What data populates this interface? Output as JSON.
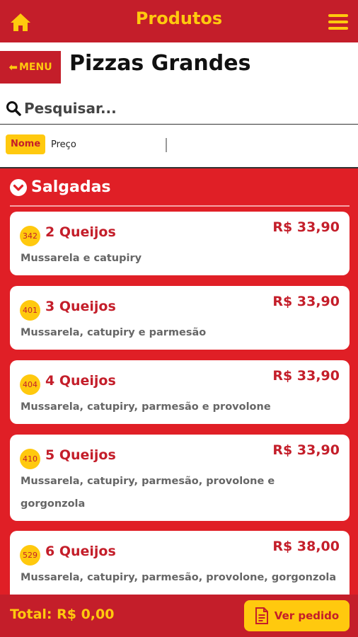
{
  "topbar": {
    "title": "Produtos",
    "home_icon": "home-icon",
    "menu_icon": "hamburger-icon"
  },
  "header": {
    "menu_button_label": "MENU",
    "category_title": "Pizzas Grandes"
  },
  "search": {
    "placeholder": "Pesquisar..."
  },
  "sort": {
    "options": [
      "Nome",
      "Preço"
    ],
    "selected": "Nome"
  },
  "section": {
    "title": "Salgadas"
  },
  "products": [
    {
      "code": "342",
      "name": "2 Queijos",
      "price": "R$ 33,90",
      "description": "Mussarela e catupiry"
    },
    {
      "code": "401",
      "name": "3 Queijos",
      "price": "R$ 33,90",
      "description": "Mussarela, catupiry e parmesão"
    },
    {
      "code": "404",
      "name": "4 Queijos",
      "price": "R$ 33,90",
      "description": "Mussarela, catupiry, parmesão e provolone"
    },
    {
      "code": "410",
      "name": "5 Queijos",
      "price": "R$ 33,90",
      "description": "Mussarela, catupiry, parmesão, provolone e gorgonzola"
    },
    {
      "code": "529",
      "name": "6 Queijos",
      "price": "R$ 38,00",
      "description": "Mussarela, catupiry, parmesão, provolone, gorgonzola e cheddar"
    }
  ],
  "footer": {
    "total": "Total: R$ 0,00",
    "order_button": "Ver pedido"
  },
  "colors": {
    "primary": "#c41e2a",
    "accent": "#ffc90e",
    "background": "#e01f26"
  }
}
